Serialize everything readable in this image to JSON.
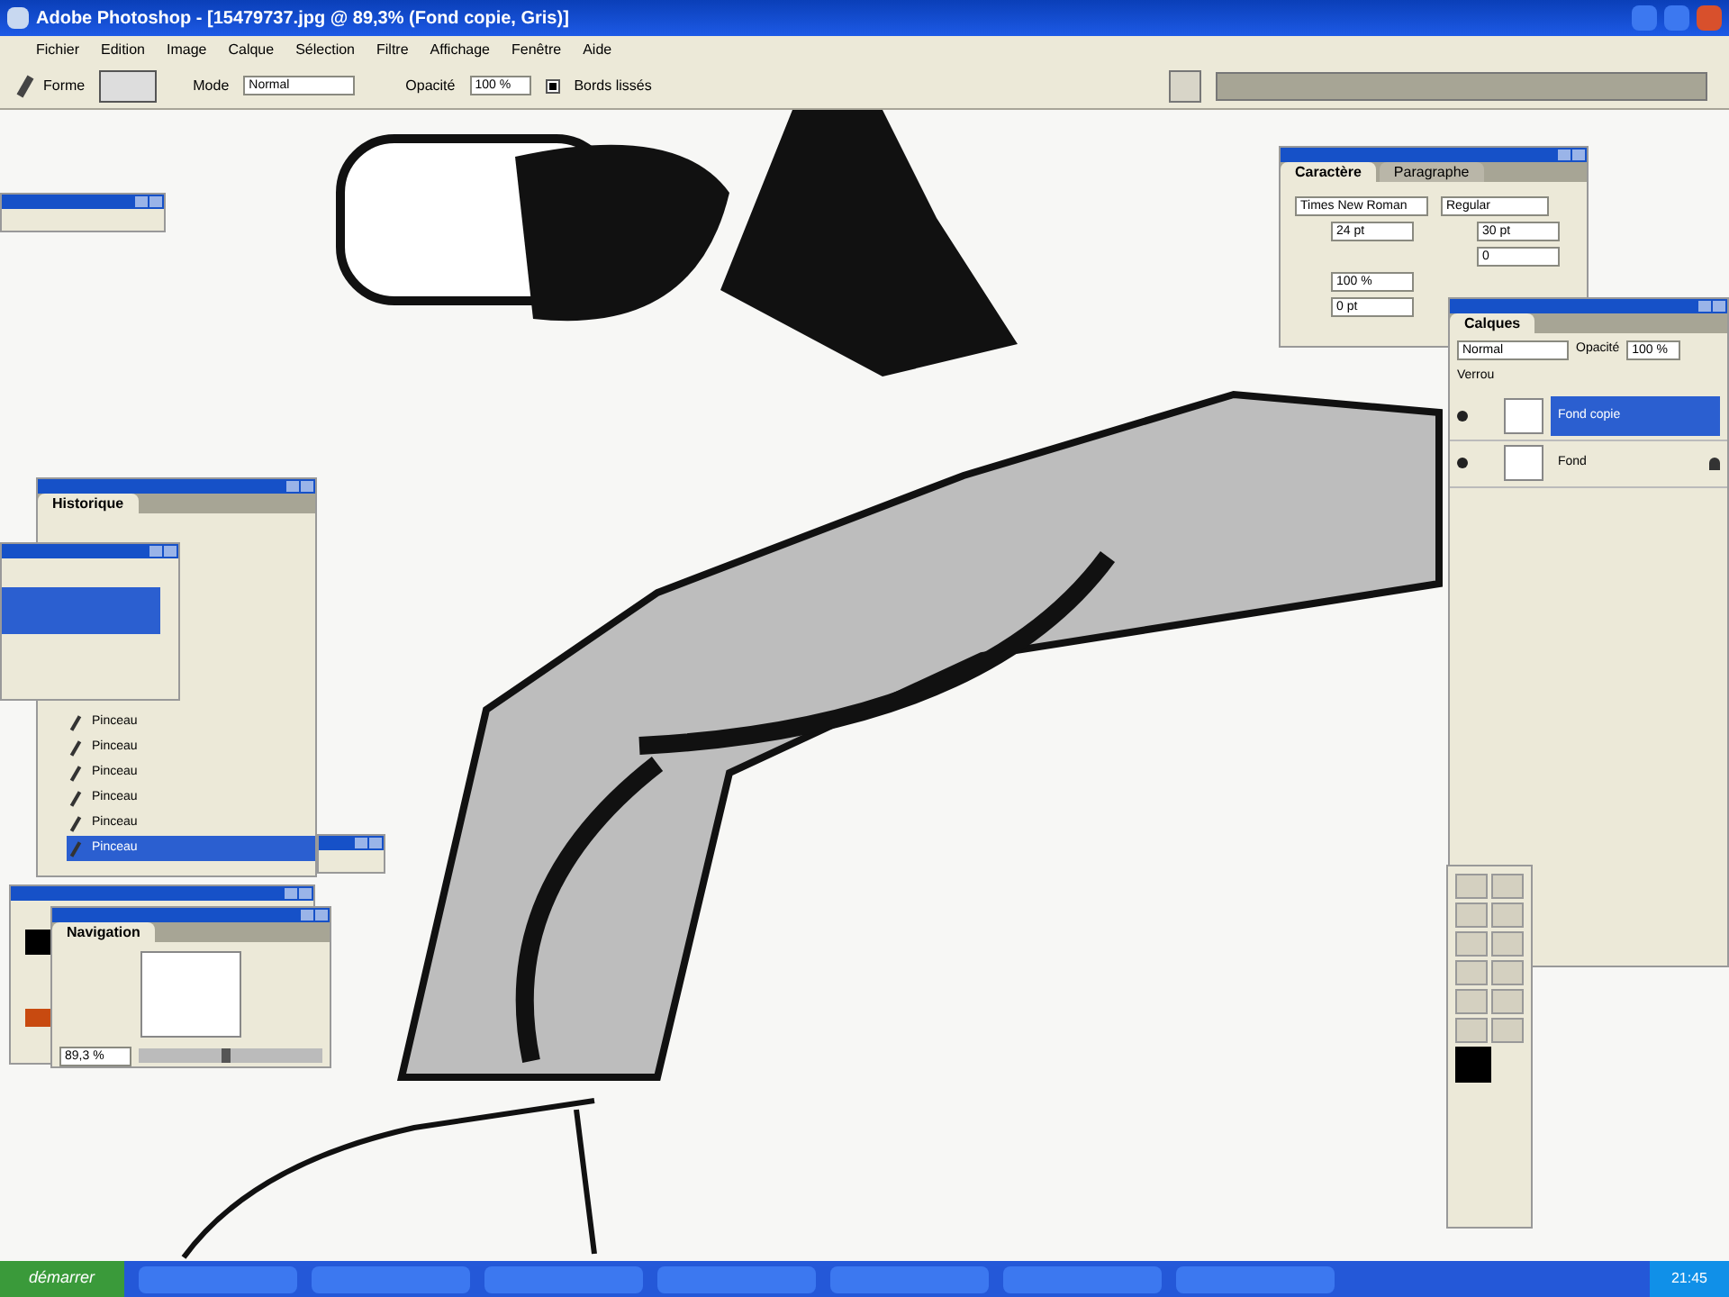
{
  "window": {
    "title": "Adobe Photoshop - [15479737.jpg @ 89,3% (Fond copie, Gris)]"
  },
  "menu": [
    "Fichier",
    "Edition",
    "Image",
    "Calque",
    "Sélection",
    "Filtre",
    "Affichage",
    "Fenêtre",
    "Aide"
  ],
  "options": {
    "shape_label": "Forme",
    "mode_label": "Mode",
    "mode": "Normal",
    "opacity_label": "Opacité",
    "opacity": "100 %",
    "antialias": {
      "label": "Bords lissés",
      "checked": true
    }
  },
  "character": {
    "tabs": [
      {
        "label": "Caractère",
        "selected": true
      },
      {
        "label": "Paragraphe",
        "selected": false
      }
    ],
    "font": "Times New Roman",
    "style": "Regular",
    "size": "24 pt",
    "leading": "30 pt",
    "tracking": "0",
    "scale": "100 %",
    "baseline": "0 pt"
  },
  "layers": {
    "tab": "Calques",
    "mode": "Normal",
    "opacity_label": "Opacité",
    "opacity": "100 %",
    "lock_label": "Verrou",
    "items": [
      {
        "name": "Fond copie",
        "selected": true,
        "locked": false
      },
      {
        "name": "Fond",
        "selected": false,
        "locked": true
      }
    ]
  },
  "history": {
    "tab": "Historique",
    "items": [
      {
        "name": "Pinceau",
        "selected": false
      },
      {
        "name": "Pinceau",
        "selected": false
      },
      {
        "name": "Pinceau",
        "selected": false
      },
      {
        "name": "Pinceau",
        "selected": false
      },
      {
        "name": "Pinceau",
        "selected": false
      },
      {
        "name": "Pinceau",
        "selected": true
      }
    ]
  },
  "navigator": {
    "tab": "Navigation",
    "zoom": "89,3 %",
    "level": 0.45
  },
  "taskbar": {
    "start": "démarrer",
    "clock": "21:45"
  }
}
